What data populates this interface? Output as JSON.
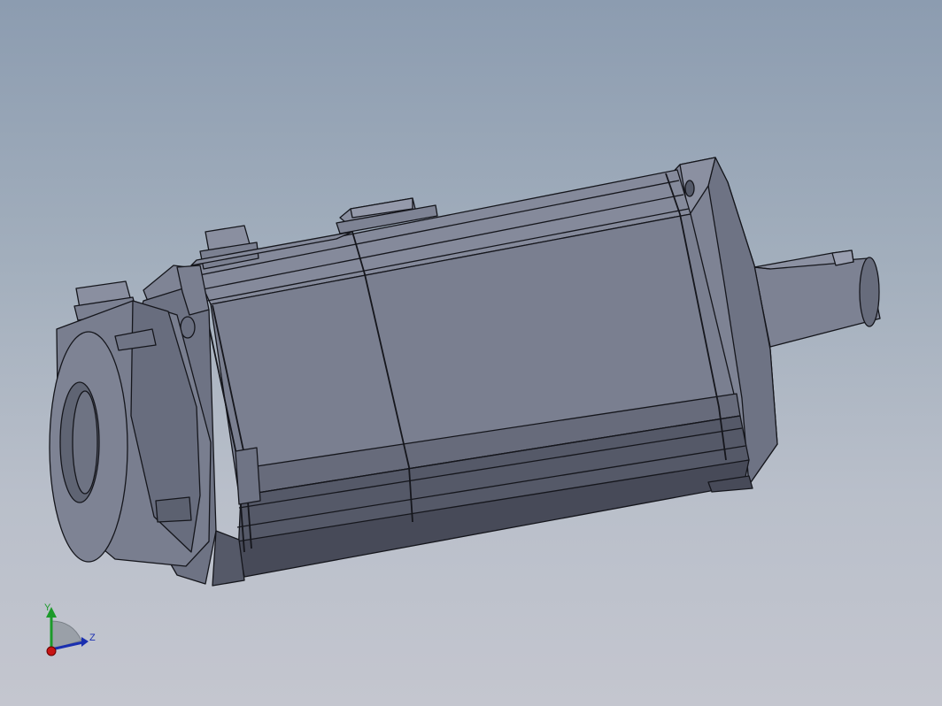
{
  "viewport": {
    "background_top": "#8c9cb0",
    "background_bottom": "#c4c6cf"
  },
  "model": {
    "shade_light": "#858a9a",
    "shade_mid": "#767b8c",
    "shade_dark": "#4f5362",
    "shade_darkest": "#3e414e",
    "edge_color": "#15161c"
  },
  "triad": {
    "y_label": "Y",
    "z_label": "Z",
    "y_color": "#1c9a2a",
    "z_color": "#1a2fb0",
    "x_color": "#c81414",
    "plane_color": "#9aa0a8"
  }
}
